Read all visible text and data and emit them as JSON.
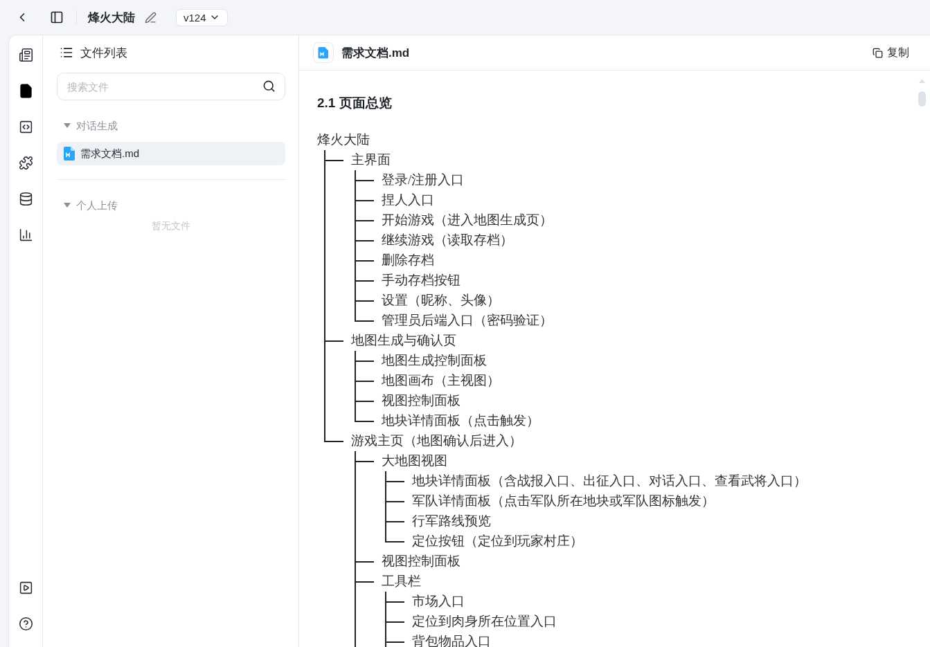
{
  "topbar": {
    "title": "烽火大陆",
    "version": "v124"
  },
  "rail": [
    {
      "selected": false
    },
    {
      "selected": true
    },
    {
      "selected": false
    },
    {
      "selected": false
    },
    {
      "selected": false
    },
    {
      "selected": false
    }
  ],
  "rail_bottom": [
    {
      "selected": false
    },
    {
      "selected": false
    }
  ],
  "file_panel": {
    "title": "文件列表",
    "search": {
      "placeholder": "搜索文件"
    },
    "sections": [
      {
        "label": "对话生成",
        "expanded": true,
        "files": [
          {
            "name": "需求文档.md",
            "selected": true
          }
        ]
      },
      {
        "label": "个人上传",
        "expanded": true,
        "empty": "暂无文件"
      }
    ]
  },
  "document": {
    "filename": "需求文档.md",
    "copy": "复制",
    "heading": "2.1 页面总览",
    "tree": {
      "label": "烽火大陆",
      "children": [
        {
          "label": "主界面",
          "children": [
            {
              "label": "登录/注册入口"
            },
            {
              "label": "捏人入口"
            },
            {
              "label": "开始游戏（进入地图生成页）"
            },
            {
              "label": "继续游戏（读取存档）"
            },
            {
              "label": "删除存档"
            },
            {
              "label": "手动存档按钮"
            },
            {
              "label": "设置（昵称、头像）"
            },
            {
              "label": "管理员后端入口（密码验证）"
            }
          ]
        },
        {
          "label": "地图生成与确认页",
          "children": [
            {
              "label": "地图生成控制面板"
            },
            {
              "label": "地图画布（主视图）"
            },
            {
              "label": "视图控制面板"
            },
            {
              "label": "地块详情面板（点击触发）"
            }
          ]
        },
        {
          "label": "游戏主页（地图确认后进入）",
          "children": [
            {
              "label": "大地图视图",
              "children": [
                {
                  "label": "地块详情面板（含战报入口、出征入口、对话入口、查看武将入口）"
                },
                {
                  "label": "军队详情面板（点击军队所在地块或军队图标触发）"
                },
                {
                  "label": "行军路线预览"
                },
                {
                  "label": "定位按钮（定位到玩家村庄）"
                }
              ]
            },
            {
              "label": "视图控制面板"
            },
            {
              "label": "工具栏",
              "more": true,
              "children": [
                {
                  "label": "市场入口"
                },
                {
                  "label": "定位到肉身所在位置入口"
                },
                {
                  "label": "背包物品入口"
                }
              ]
            }
          ],
          "more": true
        }
      ]
    }
  }
}
